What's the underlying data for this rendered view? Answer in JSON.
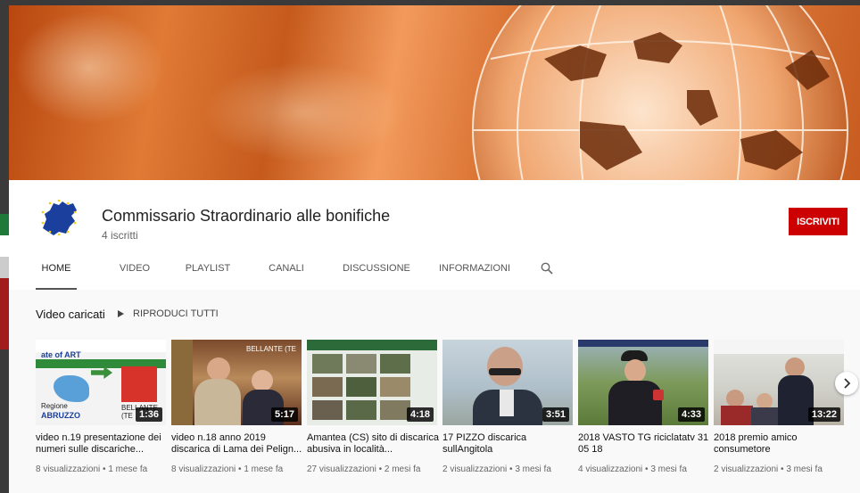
{
  "channel": {
    "name": "Commissario Straordinario alle bonifiche",
    "subscribers": "4 iscritti",
    "subscribe_label": "ISCRIVITI"
  },
  "tabs": [
    {
      "label": "HOME",
      "active": true
    },
    {
      "label": "VIDEO",
      "active": false
    },
    {
      "label": "PLAYLIST",
      "active": false
    },
    {
      "label": "CANALI",
      "active": false
    },
    {
      "label": "DISCUSSIONE",
      "active": false
    },
    {
      "label": "INFORMAZIONI",
      "active": false
    }
  ],
  "section": {
    "title": "Video caricati",
    "play_all": "RIPRODUCI TUTTI"
  },
  "videos": [
    {
      "title": "video n.19 presentazione dei numeri sulle discariche...",
      "duration": "1:36",
      "meta": "8 visualizzazioni • 1 mese fa"
    },
    {
      "title": "video n.18 anno 2019 discarica di Lama dei Pelign...",
      "duration": "5:17",
      "meta": "8 visualizzazioni • 1 mese fa"
    },
    {
      "title": "Amantea (CS) sito di discarica abusiva in località...",
      "duration": "4:18",
      "meta": "27 visualizzazioni • 2 mesi fa"
    },
    {
      "title": "17 PIZZO discarica sullAngitola",
      "duration": "3:51",
      "meta": "2 visualizzazioni • 3 mesi fa"
    },
    {
      "title": "2018 VASTO TG riciclatatv 31 05 18",
      "duration": "4:33",
      "meta": "4 visualizzazioni • 3 mesi fa"
    },
    {
      "title": "2018 premio amico consumetore",
      "duration": "13:22",
      "meta": "2 visualizzazioni • 3 mesi fa"
    }
  ],
  "thumb_text": {
    "v1_top": "ate of ART",
    "v1_region": "Regione",
    "v1_region_name": "ABRUZZO",
    "v1_place": "BELLANTE (TE",
    "v2_place": "BELLANTE (TE"
  },
  "colors": {
    "accent_red": "#cc0000",
    "banner_orange": "#e07a35"
  },
  "icons": [
    "search-icon",
    "play-icon",
    "chevron-right-icon",
    "eu-map-icon",
    "globe-icon"
  ]
}
